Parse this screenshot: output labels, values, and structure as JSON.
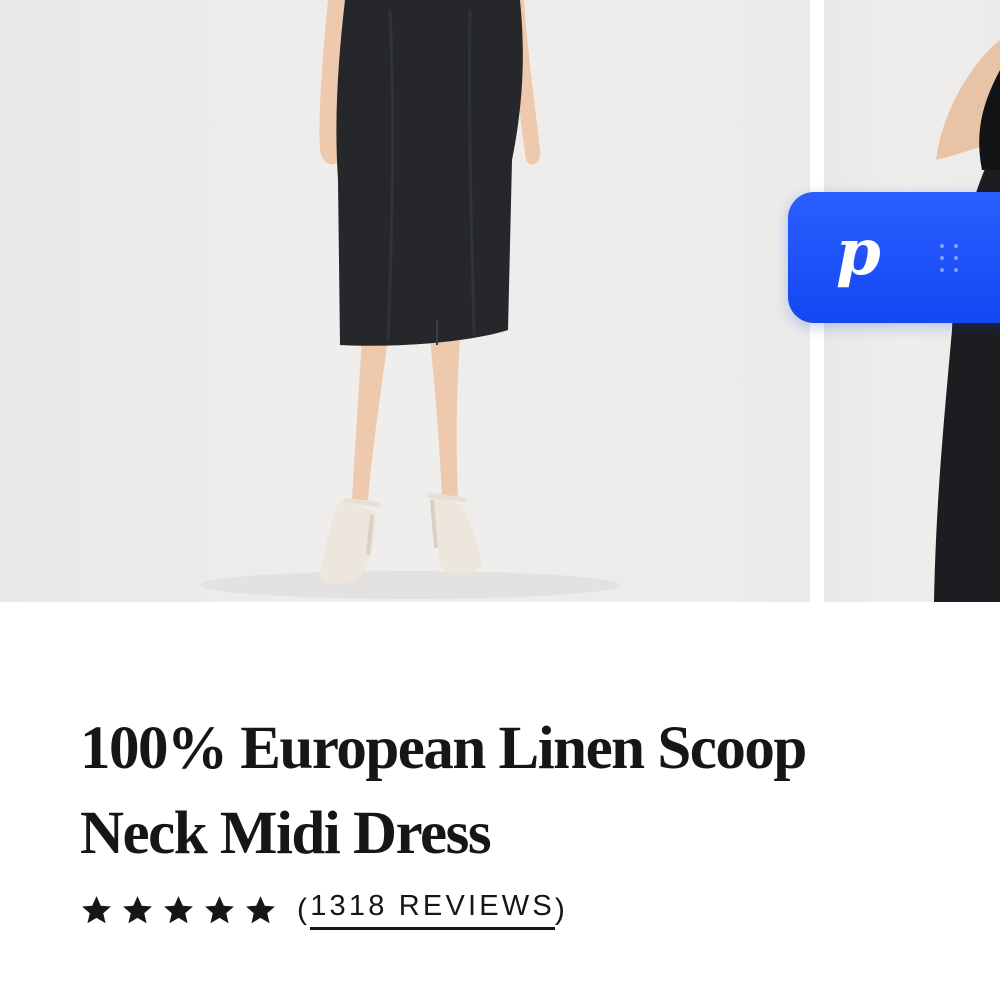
{
  "product": {
    "title_line1": "100% European Linen Scoop",
    "title_line2": "Neck Midi Dress",
    "rating": {
      "stars": 5,
      "stars_filled": 5
    },
    "reviews": {
      "open": "(",
      "label": "1318 REVIEWS",
      "close": ")"
    }
  },
  "widget": {
    "logo_text": "p",
    "icon": "drag-handle-icon"
  },
  "gallery": {
    "images": [
      {
        "subject": "model-in-black-linen-midi-dress"
      },
      {
        "subject": "model-side-view-partial"
      }
    ]
  },
  "colors": {
    "widget_blue": "#1446f2",
    "text": "#161616",
    "background": "#ffffff"
  }
}
